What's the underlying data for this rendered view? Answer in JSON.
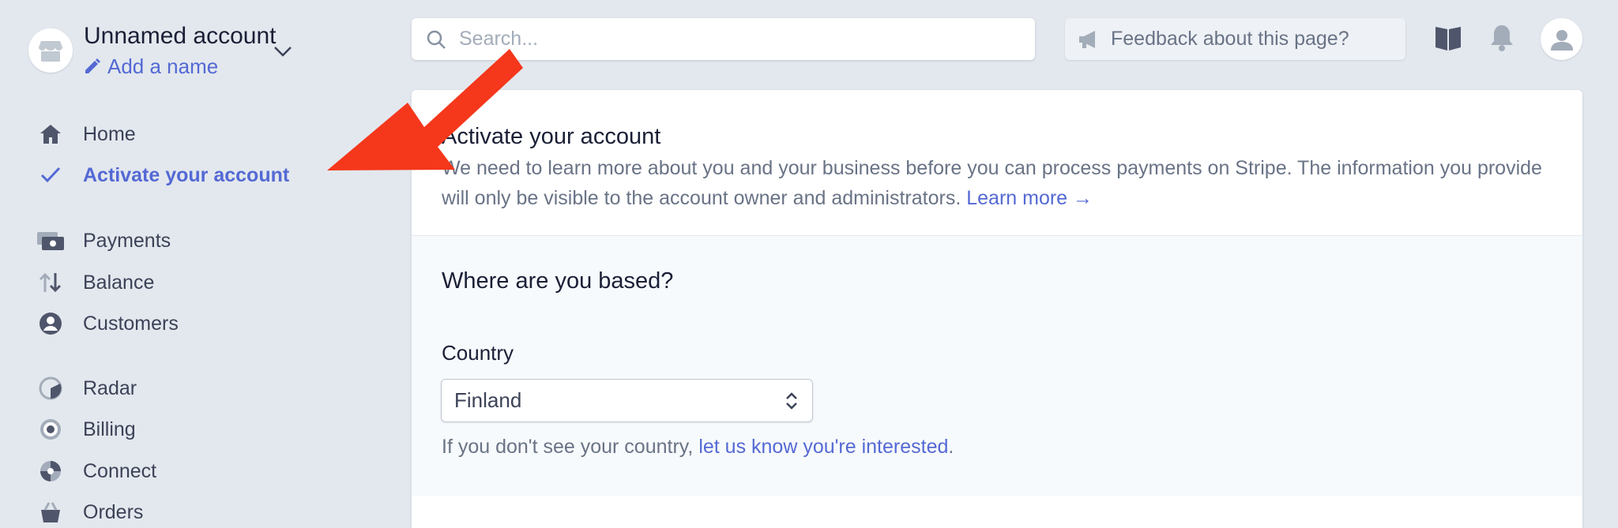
{
  "account": {
    "name": "Unnamed account",
    "add_name": "Add a name"
  },
  "nav": {
    "items": [
      {
        "label": "Home",
        "icon": "home-icon"
      },
      {
        "label": "Activate your account",
        "icon": "check-icon",
        "active": true
      },
      {
        "label": "Payments",
        "icon": "payments-icon"
      },
      {
        "label": "Balance",
        "icon": "balance-icon"
      },
      {
        "label": "Customers",
        "icon": "customers-icon"
      },
      {
        "label": "Radar",
        "icon": "radar-icon"
      },
      {
        "label": "Billing",
        "icon": "billing-icon"
      },
      {
        "label": "Connect",
        "icon": "connect-icon"
      },
      {
        "label": "Orders",
        "icon": "orders-icon"
      }
    ]
  },
  "topbar": {
    "search_placeholder": "Search...",
    "feedback_label": "Feedback about this page?"
  },
  "main": {
    "title": "Activate your account",
    "description": "We need to learn more about you and your business before you can process payments on Stripe. The information you provide will only be visible to the account owner and administrators.",
    "learn_more": "Learn more →",
    "section_title": "Where are you based?",
    "country_label": "Country",
    "country_value": "Finland",
    "hint_prefix": "If you don't see your country,",
    "hint_link": "let us know you're interested",
    "hint_suffix": "."
  },
  "colors": {
    "accent": "#5469d4",
    "background": "#e3e8ee",
    "annotation_arrow": "#f5371b"
  }
}
